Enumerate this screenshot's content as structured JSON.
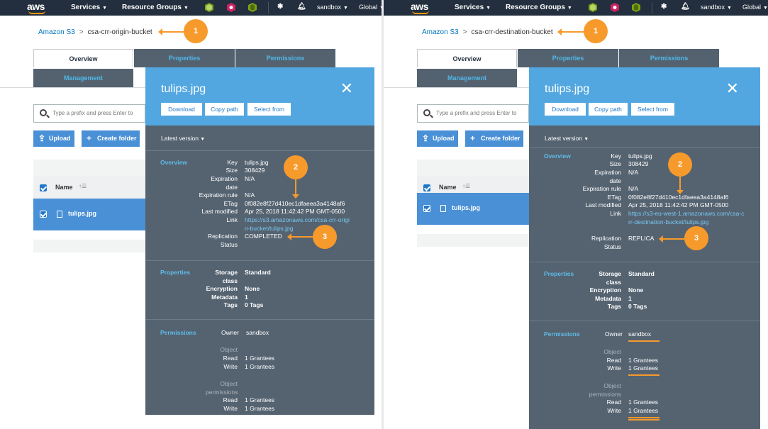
{
  "topbar": {
    "logo": "aws",
    "services": "Services",
    "resource_groups": "Resource Groups",
    "account": "sandbox",
    "region": "Global",
    "icons": [
      "cube-icon",
      "tag-icon",
      "leaf-icon",
      "pin-icon",
      "bell-icon"
    ]
  },
  "left": {
    "breadcrumb": {
      "root": "Amazon S3",
      "separator": ">",
      "bucket": "csa-crr-origin-bucket"
    },
    "tabs": [
      "Overview",
      "Properties",
      "Permissions",
      "Management"
    ],
    "search_placeholder": "Type a prefix and press Enter to",
    "upload": "Upload",
    "create_folder": "Create folder",
    "list_header": "Name",
    "file": "tulips.jpg",
    "panel": {
      "title": "tulips.jpg",
      "buttons": [
        "Download",
        "Copy path",
        "Select from"
      ],
      "version": "Latest version",
      "overview_title": "Overview",
      "overview": [
        {
          "k": "Key",
          "v": "tulips.jpg"
        },
        {
          "k": "Size",
          "v": "308429"
        },
        {
          "k": "Expiration date",
          "v": "N/A"
        },
        {
          "k": "Expiration rule",
          "v": "N/A"
        },
        {
          "k": "ETag",
          "v": "0f082e8f27d410ec1dfaeea3a4148af6"
        },
        {
          "k": "Last modified",
          "v": "Apr 25, 2018 11:42:42 PM GMT-0500"
        },
        {
          "k": "Link",
          "v": "https://s3.amazonaws.com/csa-crr-origin-bucket/tulips.jpg"
        },
        {
          "k": "Replication Status",
          "v": "COMPLETED"
        }
      ],
      "properties_title": "Properties",
      "properties": [
        {
          "k": "Storage class",
          "v": "Standard"
        },
        {
          "k": "Encryption",
          "v": "None"
        },
        {
          "k": "Metadata",
          "v": "1"
        },
        {
          "k": "Tags",
          "v": "0 Tags"
        }
      ],
      "permissions_title": "Permissions",
      "owner_label": "Owner",
      "owner": "sandbox",
      "object_label": "Object",
      "object_perms_label": "Object permissions",
      "read_label": "Read",
      "write_label": "Write",
      "grantees": "1 Grantees"
    },
    "callouts": [
      "1",
      "2",
      "3"
    ]
  },
  "right": {
    "breadcrumb": {
      "root": "Amazon S3",
      "separator": ">",
      "bucket": "csa-crr-destination-bucket"
    },
    "tabs": [
      "Overview",
      "Properties",
      "Permissions",
      "Management"
    ],
    "search_placeholder": "Type a prefix and press Enter to",
    "upload": "Upload",
    "create_folder": "Create folder",
    "list_header": "Name",
    "file": "tulips.jpg",
    "panel": {
      "title": "tulips.jpg",
      "buttons": [
        "Download",
        "Copy path",
        "Select from"
      ],
      "version": "Latest version",
      "overview_title": "Overview",
      "overview": [
        {
          "k": "Key",
          "v": "tulips.jpg"
        },
        {
          "k": "Size",
          "v": "308429"
        },
        {
          "k": "Expiration date",
          "v": "N/A"
        },
        {
          "k": "Expiration rule",
          "v": "N/A"
        },
        {
          "k": "ETag",
          "v": "0f082e8f27d410ec1dfaeea3a4148af6"
        },
        {
          "k": "Last modified",
          "v": "Apr 25, 2018 11:42:42 PM GMT-0500"
        },
        {
          "k": "Link",
          "v": "https://s3-eu-west-1.amazonaws.com/csa-crr-destination-bucket/tulips.jpg"
        },
        {
          "k": "Replication Status",
          "v": "REPLICA"
        }
      ],
      "properties_title": "Properties",
      "properties": [
        {
          "k": "Storage class",
          "v": "Standard"
        },
        {
          "k": "Encryption",
          "v": "None"
        },
        {
          "k": "Metadata",
          "v": "1"
        },
        {
          "k": "Tags",
          "v": "0 Tags"
        }
      ],
      "permissions_title": "Permissions",
      "owner_label": "Owner",
      "owner": "sandbox",
      "object_label": "Object",
      "object_perms_label": "Object permissions",
      "read_label": "Read",
      "write_label": "Write",
      "grantees": "1 Grantees"
    },
    "callouts": [
      "1",
      "2",
      "3"
    ]
  },
  "colors": {
    "accent": "#f79a2c",
    "navbar": "#232f3e",
    "panel": "#556371",
    "panel_head": "#53a7e0",
    "selection": "#4a90d6"
  }
}
